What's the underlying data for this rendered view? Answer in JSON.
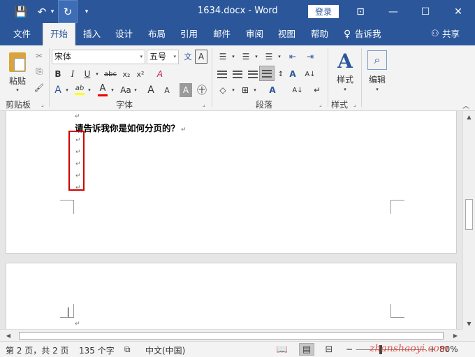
{
  "window": {
    "title": "1634.docx  -  Word",
    "login_label": "登录",
    "qa": {
      "save": "💾",
      "undo": "↶",
      "undo_caret": "▾",
      "redo": "↻",
      "customize": "▾"
    },
    "controls": {
      "ribbon_opts": "⊡",
      "minimize": "—",
      "maximize": "☐",
      "close": "✕"
    }
  },
  "tabs": {
    "file": "文件",
    "home": "开始",
    "insert": "插入",
    "design": "设计",
    "layout": "布局",
    "references": "引用",
    "mailings": "邮件",
    "review": "审阅",
    "view": "视图",
    "help": "帮助",
    "tell_me": "告诉我",
    "share": "共享",
    "tell_me_icon": "♀",
    "share_icon": "⚇"
  },
  "ribbon": {
    "clipboard": {
      "label": "剪贴板",
      "paste": "粘贴",
      "cut": "✂",
      "copy": "⎘",
      "format_painter": "🖌"
    },
    "font": {
      "label": "字体",
      "font_name": "宋体",
      "font_size": "五号",
      "bold": "B",
      "italic": "I",
      "underline": "U",
      "strike": "abc",
      "subscript": "x₂",
      "superscript": "x²",
      "grow": "A",
      "shrink": "A",
      "case": "Aa",
      "pinyin": "文",
      "border_char": "A",
      "text_effect": "A",
      "highlight": "ab",
      "font_color": "A",
      "char_shading": "A",
      "enclose": "㊉",
      "clear": "A"
    },
    "paragraph": {
      "label": "段落",
      "bullets": "☰",
      "numbering": "☰",
      "multilevel": "☰",
      "dec_indent": "⇤",
      "inc_indent": "⇥",
      "cjk": "A",
      "sort": "A↓",
      "show_marks": "↵",
      "align_left": "≡",
      "align_center": "≡",
      "align_right": "≡",
      "justify": "≡",
      "distribute": "≡",
      "line_spacing": "↕",
      "shading": "◇",
      "borders": "⊞"
    },
    "styles": {
      "label": "样式",
      "icon": "A"
    },
    "editing": {
      "label": "编辑",
      "icon": "⌕"
    },
    "launcher": "⌟",
    "collapse": "︿"
  },
  "document": {
    "line1": "请告诉我你是如何分页的？",
    "para_mark": "↵"
  },
  "statusbar": {
    "page": "第 2 页，共 2 页",
    "words": "135 个字",
    "lang": "中文(中国)",
    "zoom": "80%",
    "zoom_minus": "−",
    "zoom_plus": "+",
    "proof_icon": "⧉",
    "read_mode": "📖",
    "print_layout": "▤",
    "web_layout": "⊟"
  },
  "scroll": {
    "up": "▲",
    "down": "▼",
    "left": "◀",
    "right": "▶"
  },
  "watermark": "zhanshaoyi.com"
}
